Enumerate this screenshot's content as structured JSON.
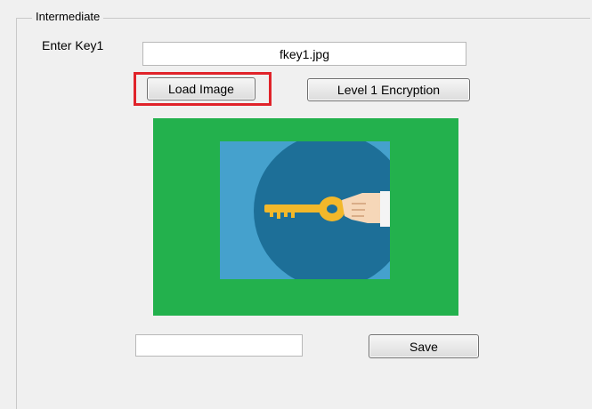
{
  "panel": {
    "title": "Intermediate"
  },
  "key_input": {
    "label": "Enter Key1",
    "value": "fkey1.jpg"
  },
  "buttons": {
    "load_image": "Load Image",
    "level1_encryption": "Level 1 Encryption",
    "save": "Save"
  },
  "output_field": {
    "value": ""
  },
  "image": {
    "subject": "key-in-hand-icon",
    "background_color": "#23b14d",
    "tile_color": "#45a1cd",
    "circle_color": "#1d6f98",
    "key_color": "#f2b82a"
  },
  "highlight": {
    "color": "#e0232a",
    "target": "load_image"
  }
}
